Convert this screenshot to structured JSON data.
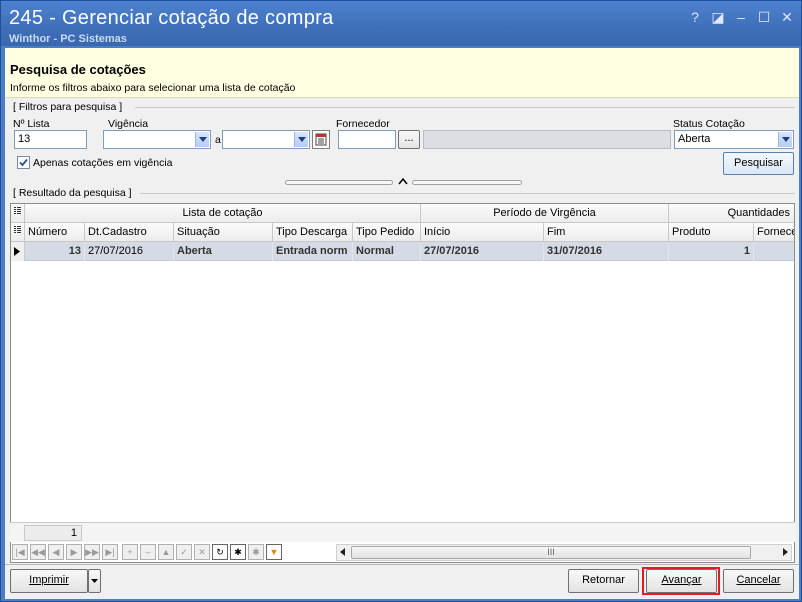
{
  "window": {
    "title": "245 - Gerenciar cotação de compra",
    "subtitle": "Winthor - PC Sistemas",
    "help_glyph": "?",
    "restore_glyph": "◪",
    "minimize_glyph": "–",
    "maximize_glyph": "☐",
    "close_glyph": "✕"
  },
  "header": {
    "title": "Pesquisa de cotações",
    "subtitle": "Informe os filtros abaixo para selecionar uma lista de cotação"
  },
  "filters": {
    "group_title": "[ Filtros para pesquisa ]",
    "lista_label": "Nº Lista",
    "lista_value": "13",
    "vigencia_label": "Vigência",
    "vigencia_from": "",
    "a_label": "a",
    "vigencia_to": "",
    "fornecedor_label": "Fornecedor",
    "fornecedor_code": "",
    "fornecedor_btn": "...",
    "fornecedor_name": "",
    "status_label": "Status Cotação",
    "status_value": "Aberta",
    "checkbox_label": "Apenas cotações em vigência",
    "checkbox_checked": true,
    "search_button": "Pesquisar"
  },
  "results": {
    "group_title": "[ Resultado da pesquisa ]",
    "bands": [
      "Lista de cotação",
      "Período de Virgência",
      "Quantidades"
    ],
    "columns": [
      "Número",
      "Dt.Cadastro",
      "Situação",
      "Tipo Descarga",
      "Tipo Pedido",
      "Início",
      "Fim",
      "Produto",
      "Fornecedor"
    ],
    "rows": [
      [
        "13",
        "27/07/2016",
        "Aberta",
        "Entrada norm",
        "Normal",
        "27/07/2016",
        "31/07/2016",
        "1",
        ""
      ]
    ],
    "footer_count": "1"
  },
  "buttons": {
    "imprimir": "Imprimir",
    "retornar": "Retornar",
    "avancar": "Avançar",
    "cancelar": "Cancelar"
  },
  "colors": {
    "titlebar": "#4677c2",
    "header_bg": "#ffffe1",
    "selected_row": "#d4dbe4",
    "highlight_border": "#e31b23"
  }
}
